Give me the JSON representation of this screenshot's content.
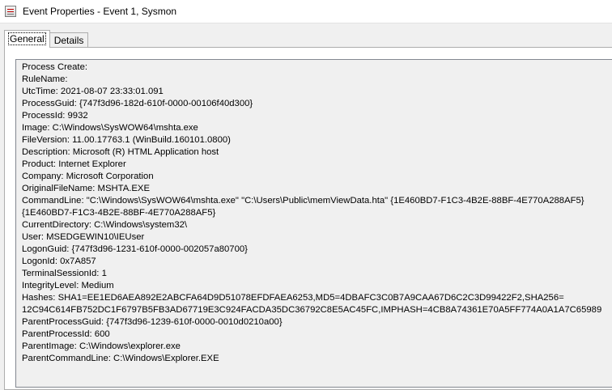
{
  "window": {
    "title": "Event Properties - Event 1, Sysmon"
  },
  "tabs": [
    {
      "label": "General",
      "active": true
    },
    {
      "label": "Details",
      "active": false
    }
  ],
  "event_detail": {
    "lines": [
      "Process Create:",
      "RuleName:",
      "UtcTime: 2021-08-07 23:33:01.091",
      "ProcessGuid: {747f3d96-182d-610f-0000-00106f40d300}",
      "ProcessId: 9932",
      "Image: C:\\Windows\\SysWOW64\\mshta.exe",
      "FileVersion: 11.00.17763.1 (WinBuild.160101.0800)",
      "Description: Microsoft (R) HTML Application host",
      "Product: Internet Explorer",
      "Company: Microsoft Corporation",
      "OriginalFileName: MSHTA.EXE",
      "CommandLine: \"C:\\Windows\\SysWOW64\\mshta.exe\" \"C:\\Users\\Public\\memViewData.hta\" {1E460BD7-F1C3-4B2E-88BF-4E770A288AF5}",
      "{1E460BD7-F1C3-4B2E-88BF-4E770A288AF5}",
      "CurrentDirectory: C:\\Windows\\system32\\",
      "User: MSEDGEWIN10\\IEUser",
      "LogonGuid: {747f3d96-1231-610f-0000-002057a80700}",
      "LogonId: 0x7A857",
      "TerminalSessionId: 1",
      "IntegrityLevel: Medium",
      "Hashes: SHA1=EE1ED6AEA892E2ABCFA64D9D51078EFDFAEA6253,MD5=4DBAFC3C0B7A9CAA67D6C2C3D99422F2,SHA256=",
      "12C94C614FB752DC1F6797B5FB3AD67719E3C924FACDA35DC36792C8E5AC45FC,IMPHASH=4CB8A74361E70A5FF774A0A1A7C65989",
      "ParentProcessGuid: {747f3d96-1239-610f-0000-0010d0210a00}",
      "ParentProcessId: 600",
      "ParentImage: C:\\Windows\\explorer.exe",
      "ParentCommandLine: C:\\Windows\\Explorer.EXE"
    ]
  }
}
